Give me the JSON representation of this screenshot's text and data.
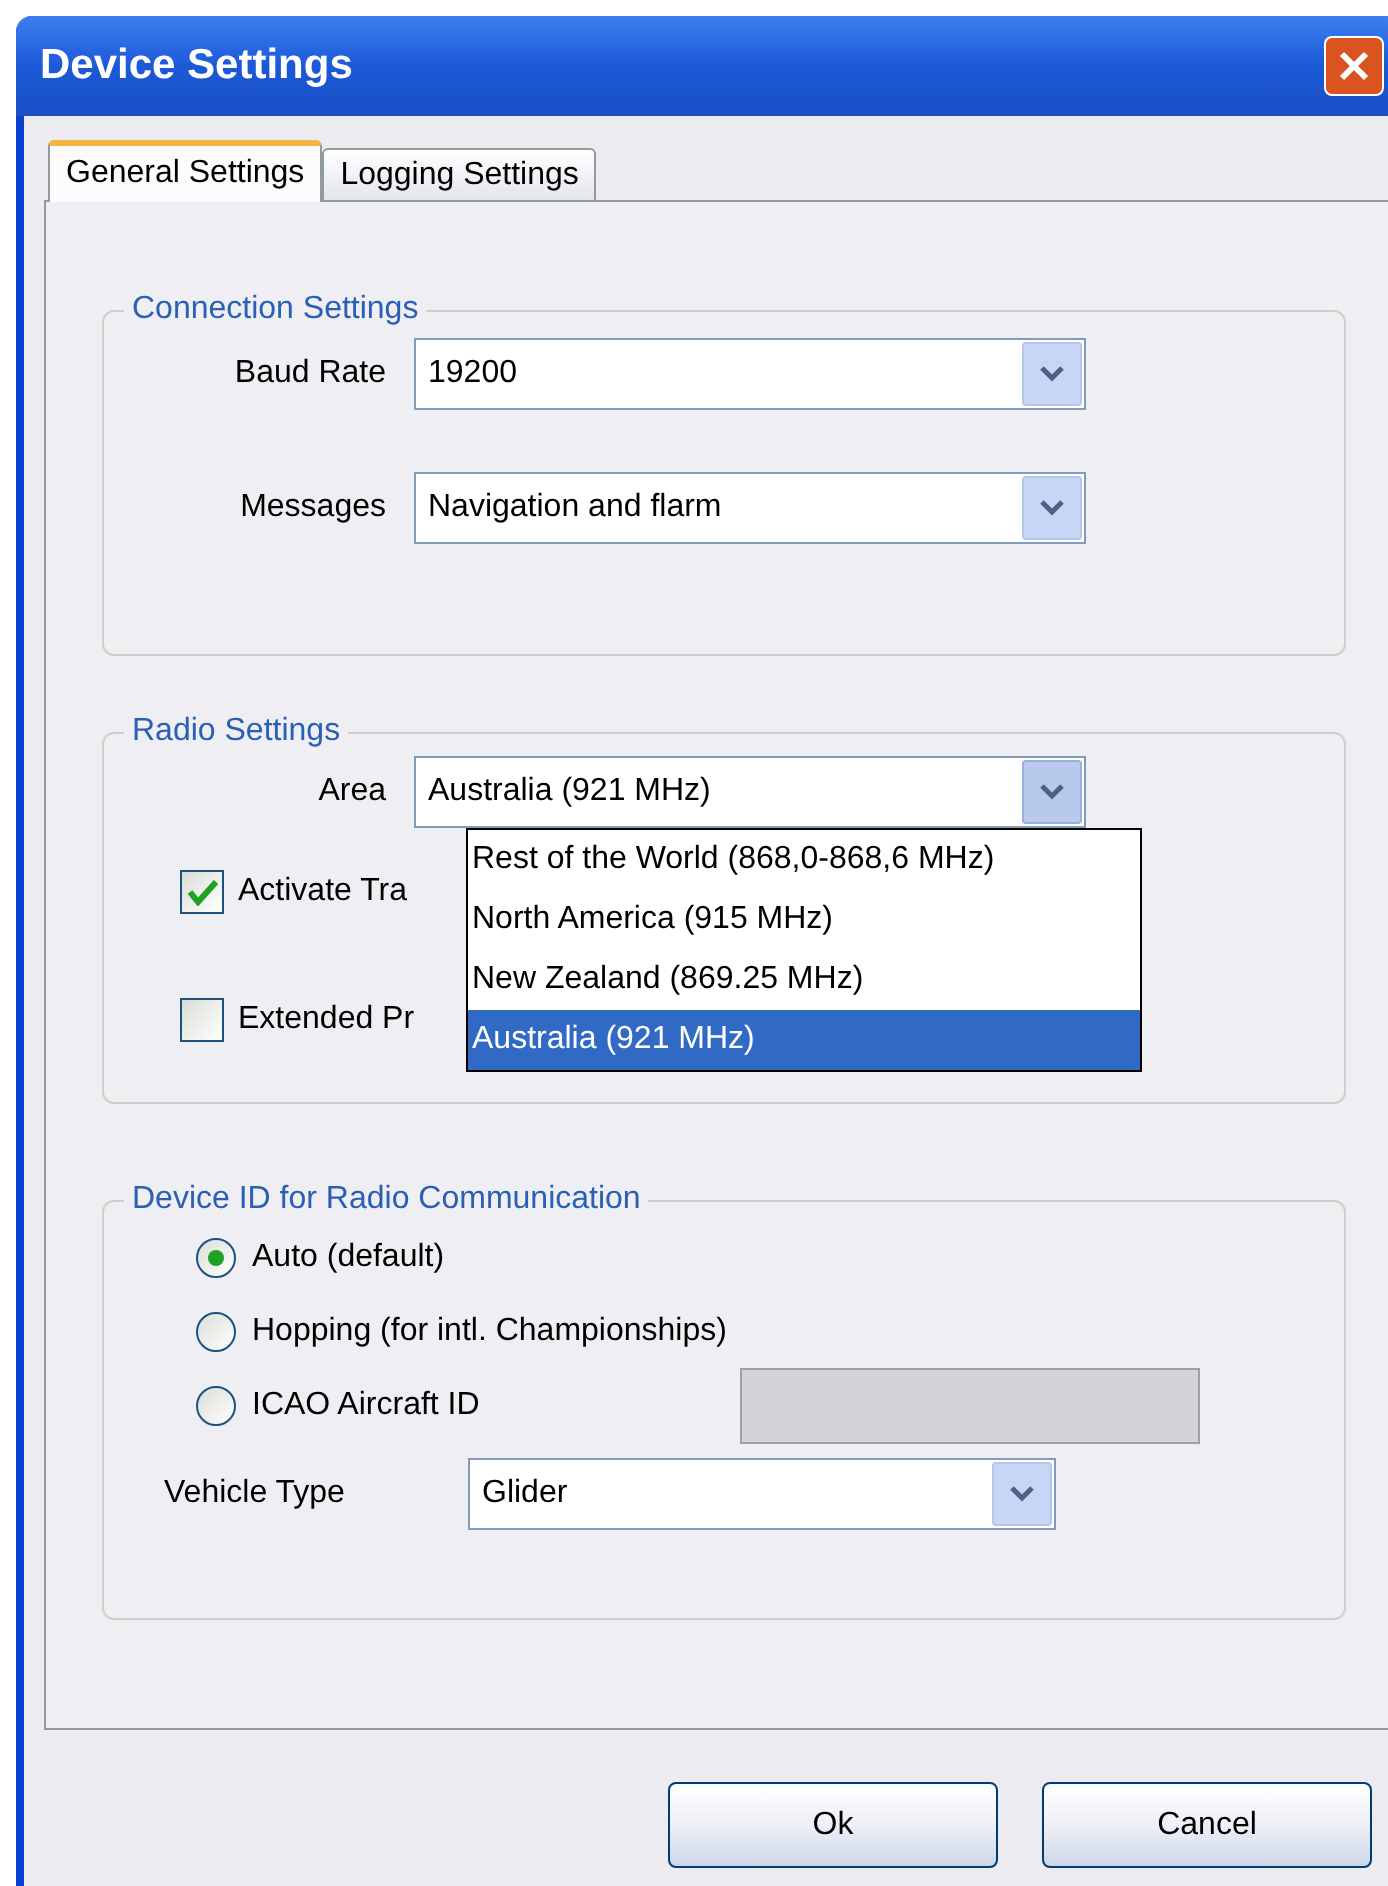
{
  "window": {
    "title": "Device Settings"
  },
  "tabs": [
    {
      "label": "General Settings",
      "selected": true
    },
    {
      "label": "Logging Settings",
      "selected": false
    }
  ],
  "connection_settings": {
    "title": "Connection Settings",
    "fields": [
      {
        "label": "Baud Rate",
        "value": "19200"
      },
      {
        "label": "Messages",
        "value": "Navigation and flarm"
      }
    ]
  },
  "radio_settings": {
    "title": "Radio Settings",
    "area": {
      "label": "Area",
      "value": "Australia (921 MHz)",
      "expanded": true,
      "options": [
        {
          "label": "Rest of the World (868,0-868,6 MHz)",
          "selected": false
        },
        {
          "label": "North America (915 MHz)",
          "selected": false
        },
        {
          "label": "New Zealand (869.25 MHz)",
          "selected": false
        },
        {
          "label": "Australia (921 MHz)",
          "selected": true
        }
      ]
    },
    "checkboxes": [
      {
        "label": "Activate Tra",
        "checked": true
      },
      {
        "label": "Extended Pr",
        "checked": false
      }
    ]
  },
  "device_id": {
    "title": "Device ID for Radio Communication",
    "options": [
      {
        "label": "Auto (default)",
        "selected": true
      },
      {
        "label": "Hopping (for intl. Championships)",
        "selected": false
      },
      {
        "label": "ICAO Aircraft ID",
        "selected": false
      }
    ],
    "icao_field": {
      "disabled": true
    },
    "vehicle_type": {
      "label": "Vehicle Type",
      "value": "Glider"
    }
  },
  "buttons": [
    "Ok",
    "Cancel"
  ]
}
